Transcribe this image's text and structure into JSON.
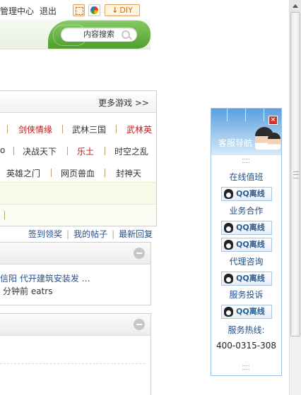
{
  "topbar": {
    "admin_label": "管理中心",
    "logout_label": "退出",
    "diy_label": "DIY",
    "expand_icon": "expand-icon",
    "color_icon": "color-wheel-icon"
  },
  "search": {
    "label": "内容搜索",
    "icon": "search-icon"
  },
  "games": {
    "more_label": "更多游戏 >>",
    "row1": [
      "剑侠情缘",
      "武林三国",
      "武林英"
    ],
    "row2": [
      "o",
      "决战天下",
      "乐土",
      "时空之乱"
    ],
    "row3": [
      "英雄之门",
      "网页兽血",
      "封神天"
    ],
    "highlight_color": "#c2191d"
  },
  "links": {
    "signin": "签到领奖",
    "my_posts": "我的帖子",
    "latest_replies": "最新回复"
  },
  "thread": {
    "title": "信阳 代开建筑安装发 …",
    "meta": "分钟前 eatrs"
  },
  "cs_widget": {
    "title": "客服导航",
    "close": "×",
    "duty_label": "在线值班",
    "business_label": "业务合作",
    "agent_label": "代理咨询",
    "complaint_label": "服务投诉",
    "qq_status": "QQ离线",
    "hotline_label": "服务热线:",
    "hotline_number": "400-0315-308",
    "accent_color": "#1f4f86"
  }
}
